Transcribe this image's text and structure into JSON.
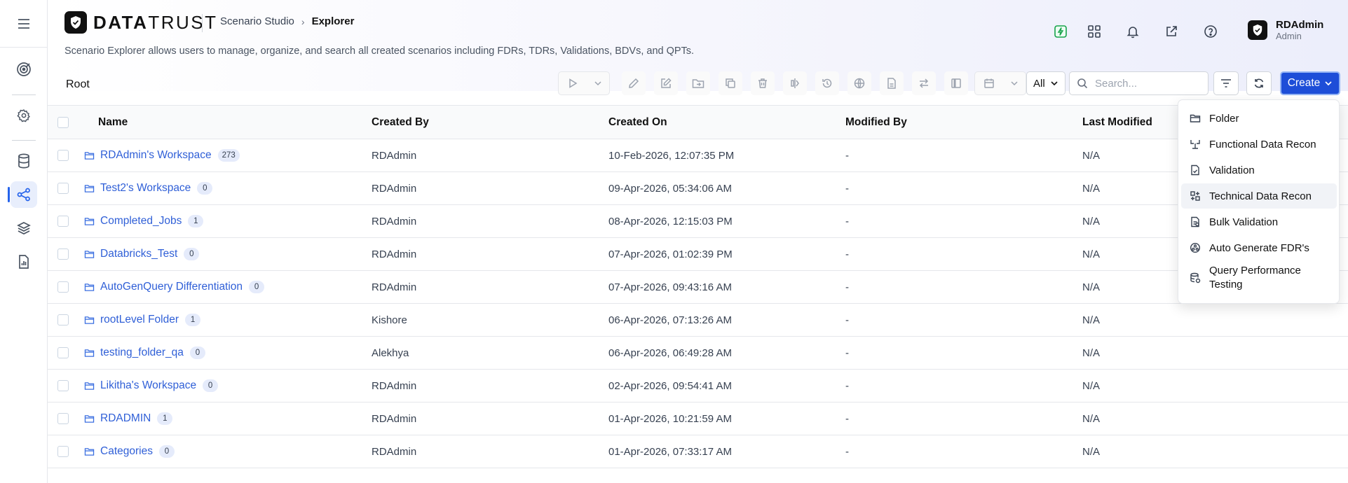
{
  "app": {
    "brand_bold": "DATA",
    "brand_light": "TRUST",
    "breadcrumb": [
      "Scenario Studio",
      "Explorer"
    ],
    "description": "Scenario Explorer allows users to manage, organize, and search all created scenarios including FDRs, TDRs, Validations, BDVs, and QPTs."
  },
  "user": {
    "name": "RDAdmin",
    "role": "Admin"
  },
  "toolbar": {
    "root_label": "Root",
    "filter_value": "All",
    "search_placeholder": "Search...",
    "create_label": "Create"
  },
  "table": {
    "columns": [
      "Name",
      "Created By",
      "Created On",
      "Modified By",
      "Last Modified"
    ],
    "rows": [
      {
        "name": "RDAdmin's Workspace",
        "count": "273",
        "created_by": "RDAdmin",
        "created_on": "10-Feb-2026, 12:07:35 PM",
        "modified_by": "-",
        "last_modified": "N/A"
      },
      {
        "name": "Test2's Workspace",
        "count": "0",
        "created_by": "RDAdmin",
        "created_on": "09-Apr-2026, 05:34:06 AM",
        "modified_by": "-",
        "last_modified": "N/A"
      },
      {
        "name": "Completed_Jobs",
        "count": "1",
        "created_by": "RDAdmin",
        "created_on": "08-Apr-2026, 12:15:03 PM",
        "modified_by": "-",
        "last_modified": "N/A"
      },
      {
        "name": "Databricks_Test",
        "count": "0",
        "created_by": "RDAdmin",
        "created_on": "07-Apr-2026, 01:02:39 PM",
        "modified_by": "-",
        "last_modified": "N/A"
      },
      {
        "name": "AutoGenQuery Differentiation",
        "count": "0",
        "created_by": "RDAdmin",
        "created_on": "07-Apr-2026, 09:43:16 AM",
        "modified_by": "-",
        "last_modified": "N/A"
      },
      {
        "name": "rootLevel Folder",
        "count": "1",
        "created_by": "Kishore",
        "created_on": "06-Apr-2026, 07:13:26 AM",
        "modified_by": "-",
        "last_modified": "N/A"
      },
      {
        "name": "testing_folder_qa",
        "count": "0",
        "created_by": "Alekhya",
        "created_on": "06-Apr-2026, 06:49:28 AM",
        "modified_by": "-",
        "last_modified": "N/A"
      },
      {
        "name": "Likitha's Workspace",
        "count": "0",
        "created_by": "RDAdmin",
        "created_on": "02-Apr-2026, 09:54:41 AM",
        "modified_by": "-",
        "last_modified": "N/A"
      },
      {
        "name": "RDADMIN",
        "count": "1",
        "created_by": "RDAdmin",
        "created_on": "01-Apr-2026, 10:21:59 AM",
        "modified_by": "-",
        "last_modified": "N/A"
      },
      {
        "name": "Categories",
        "count": "0",
        "created_by": "RDAdmin",
        "created_on": "01-Apr-2026, 07:33:17 AM",
        "modified_by": "-",
        "last_modified": "N/A"
      }
    ]
  },
  "create_menu": {
    "items": [
      {
        "label": "Folder",
        "icon": "folder-icon"
      },
      {
        "label": "Functional Data Recon",
        "icon": "functional-recon-icon"
      },
      {
        "label": "Validation",
        "icon": "validation-icon"
      },
      {
        "label": "Technical Data Recon",
        "icon": "technical-recon-icon"
      },
      {
        "label": "Bulk Validation",
        "icon": "bulk-validation-icon"
      },
      {
        "label": "Auto Generate FDR's",
        "icon": "auto-generate-icon"
      },
      {
        "label": "Query Performance Testing",
        "icon": "query-performance-icon"
      }
    ]
  },
  "colors": {
    "accent": "#1d4ed8",
    "link": "#2f5fd7",
    "active_rail": "#e8eefc"
  }
}
